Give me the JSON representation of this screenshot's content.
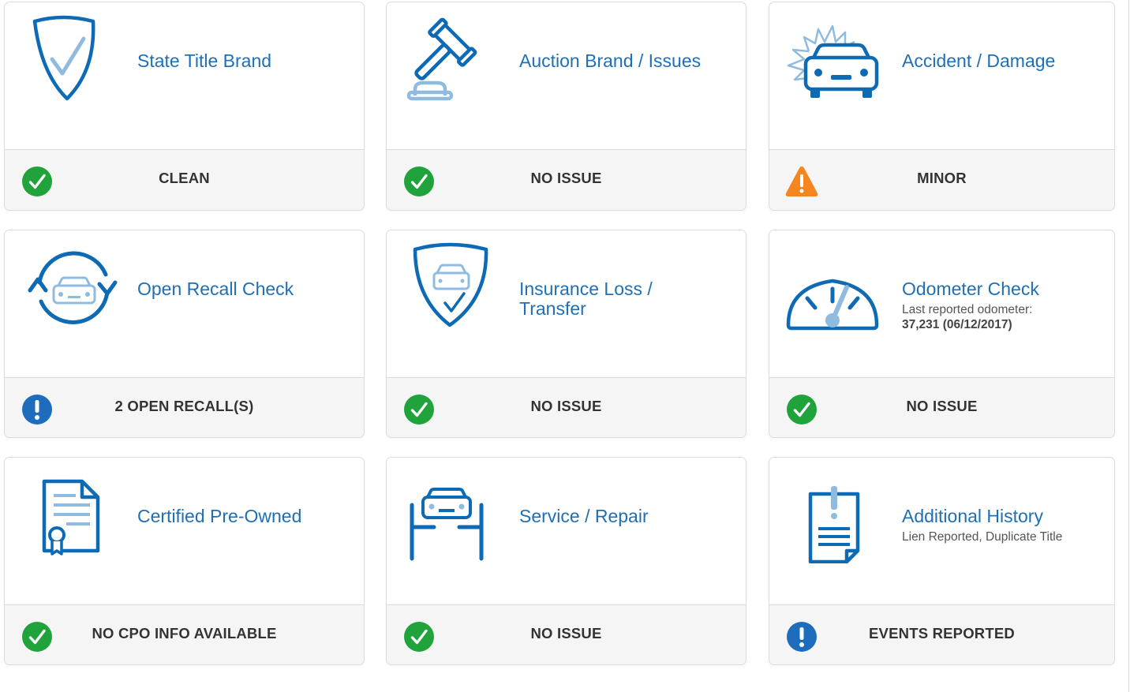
{
  "cards": [
    {
      "title": "State Title Brand",
      "status": "CLEAN",
      "icon": "shield-check-icon",
      "status_icon": "check-circle-icon"
    },
    {
      "title": "Auction Brand / Issues",
      "status": "NO ISSUE",
      "icon": "gavel-icon",
      "status_icon": "check-circle-icon"
    },
    {
      "title": "Accident / Damage",
      "status": "MINOR",
      "icon": "car-crash-icon",
      "status_icon": "warning-triangle-icon"
    },
    {
      "title": "Open Recall Check",
      "status": "2 OPEN RECALL(S)",
      "icon": "car-recall-icon",
      "status_icon": "info-exclamation-icon"
    },
    {
      "title": "Insurance Loss / Transfer",
      "status": "NO ISSUE",
      "icon": "shield-car-icon",
      "status_icon": "check-circle-icon"
    },
    {
      "title": "Odometer Check",
      "subtitle": "Last reported odometer:",
      "subtitle_strong": "37,231 (06/12/2017)",
      "status": "NO ISSUE",
      "icon": "speedometer-icon",
      "status_icon": "check-circle-icon"
    },
    {
      "title": "Certified Pre-Owned",
      "status": "NO CPO INFO AVAILABLE",
      "icon": "certificate-icon",
      "status_icon": "check-circle-icon"
    },
    {
      "title": "Service / Repair",
      "status": "NO ISSUE",
      "icon": "car-lift-icon",
      "status_icon": "check-circle-icon"
    },
    {
      "title": "Additional History",
      "subtitle": "Lien Reported, Duplicate Title",
      "status": "EVENTS REPORTED",
      "icon": "clipboard-alert-icon",
      "status_icon": "info-exclamation-icon"
    }
  ],
  "colors": {
    "brand_blue": "#1f6fb5",
    "icon_blue": "#0d6ab5",
    "icon_light_blue": "#8fbbe0",
    "success_green": "#1fa33a",
    "warning_orange": "#f4851f",
    "info_blue": "#1d6dbc"
  }
}
